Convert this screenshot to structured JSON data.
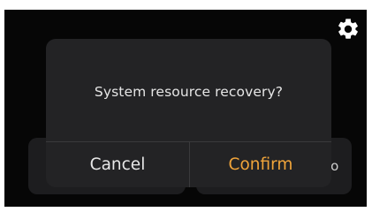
{
  "dialog": {
    "message": "System resource recovery?",
    "cancel_label": "Cancel",
    "confirm_label": "Confirm"
  },
  "background": {
    "partial_text": "ıo"
  },
  "icons": {
    "settings": "gear-icon"
  },
  "colors": {
    "screen_background": "#060606",
    "dialog_background": "#232325",
    "confirm_accent": "#f0a43a",
    "text_primary": "#e6e6e6"
  }
}
